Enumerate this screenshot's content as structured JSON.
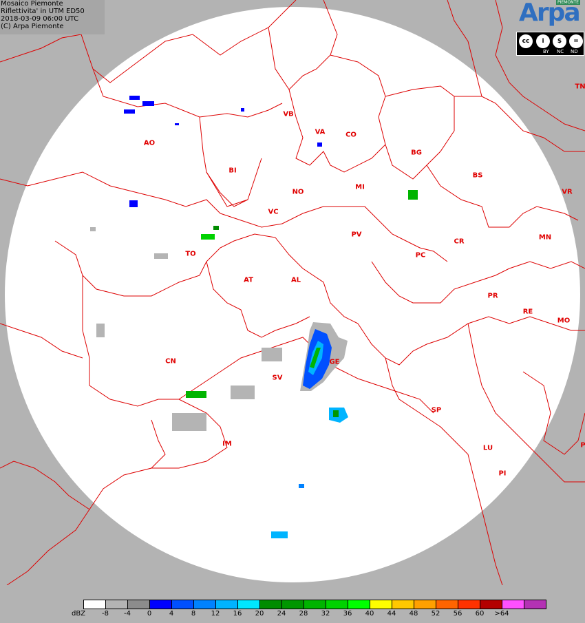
{
  "caption": {
    "line1": "Mosaico Piemonte",
    "line2": "Riflettivita' in UTM ED50",
    "line3": "2018-03-09 06:00 UTC",
    "line4": "(C) Arpa Piemonte"
  },
  "logo": {
    "name": "Arpa",
    "tag": "PIEMONTE"
  },
  "license": {
    "labels": [
      "BY",
      "NC",
      "ND"
    ],
    "badges": [
      "cc",
      "i",
      "$",
      "="
    ]
  },
  "provinces": [
    {
      "code": "AO"
    },
    {
      "code": "BI"
    },
    {
      "code": "VB"
    },
    {
      "code": "VA"
    },
    {
      "code": "CO"
    },
    {
      "code": "BG"
    },
    {
      "code": "BS"
    },
    {
      "code": "VR"
    },
    {
      "code": "TN"
    },
    {
      "code": "NO"
    },
    {
      "code": "MI"
    },
    {
      "code": "VC"
    },
    {
      "code": "TO"
    },
    {
      "code": "PV"
    },
    {
      "code": "CR"
    },
    {
      "code": "MN"
    },
    {
      "code": "PC"
    },
    {
      "code": "AT"
    },
    {
      "code": "AL"
    },
    {
      "code": "PR"
    },
    {
      "code": "RE"
    },
    {
      "code": "MO"
    },
    {
      "code": "CN"
    },
    {
      "code": "GE"
    },
    {
      "code": "SV"
    },
    {
      "code": "SP"
    },
    {
      "code": "IM"
    },
    {
      "code": "LU"
    },
    {
      "code": "PI"
    },
    {
      "code": "P"
    }
  ],
  "legend": {
    "unit": "dBZ",
    "colors": [
      "#ffffff",
      "#b4b4b4",
      "#8c8c8c",
      "#0000ff",
      "#0050ff",
      "#0082ff",
      "#00b4ff",
      "#00e6ff",
      "#008c00",
      "#009600",
      "#00b400",
      "#00d200",
      "#00ff00",
      "#ffff00",
      "#ffc800",
      "#ffa000",
      "#ff6400",
      "#ff3200",
      "#b40000",
      "#ff50ff",
      "#b432b4"
    ],
    "ticks": [
      "-8",
      "-4",
      "0",
      "4",
      "8",
      "12",
      "16",
      "20",
      "24",
      "28",
      "32",
      "36",
      "40",
      "44",
      "48",
      "52",
      "56",
      "60",
      ">64"
    ]
  },
  "colors": {
    "boundary": "#dd0000",
    "background": "#b3b3b3",
    "disk": "#ffffff"
  }
}
